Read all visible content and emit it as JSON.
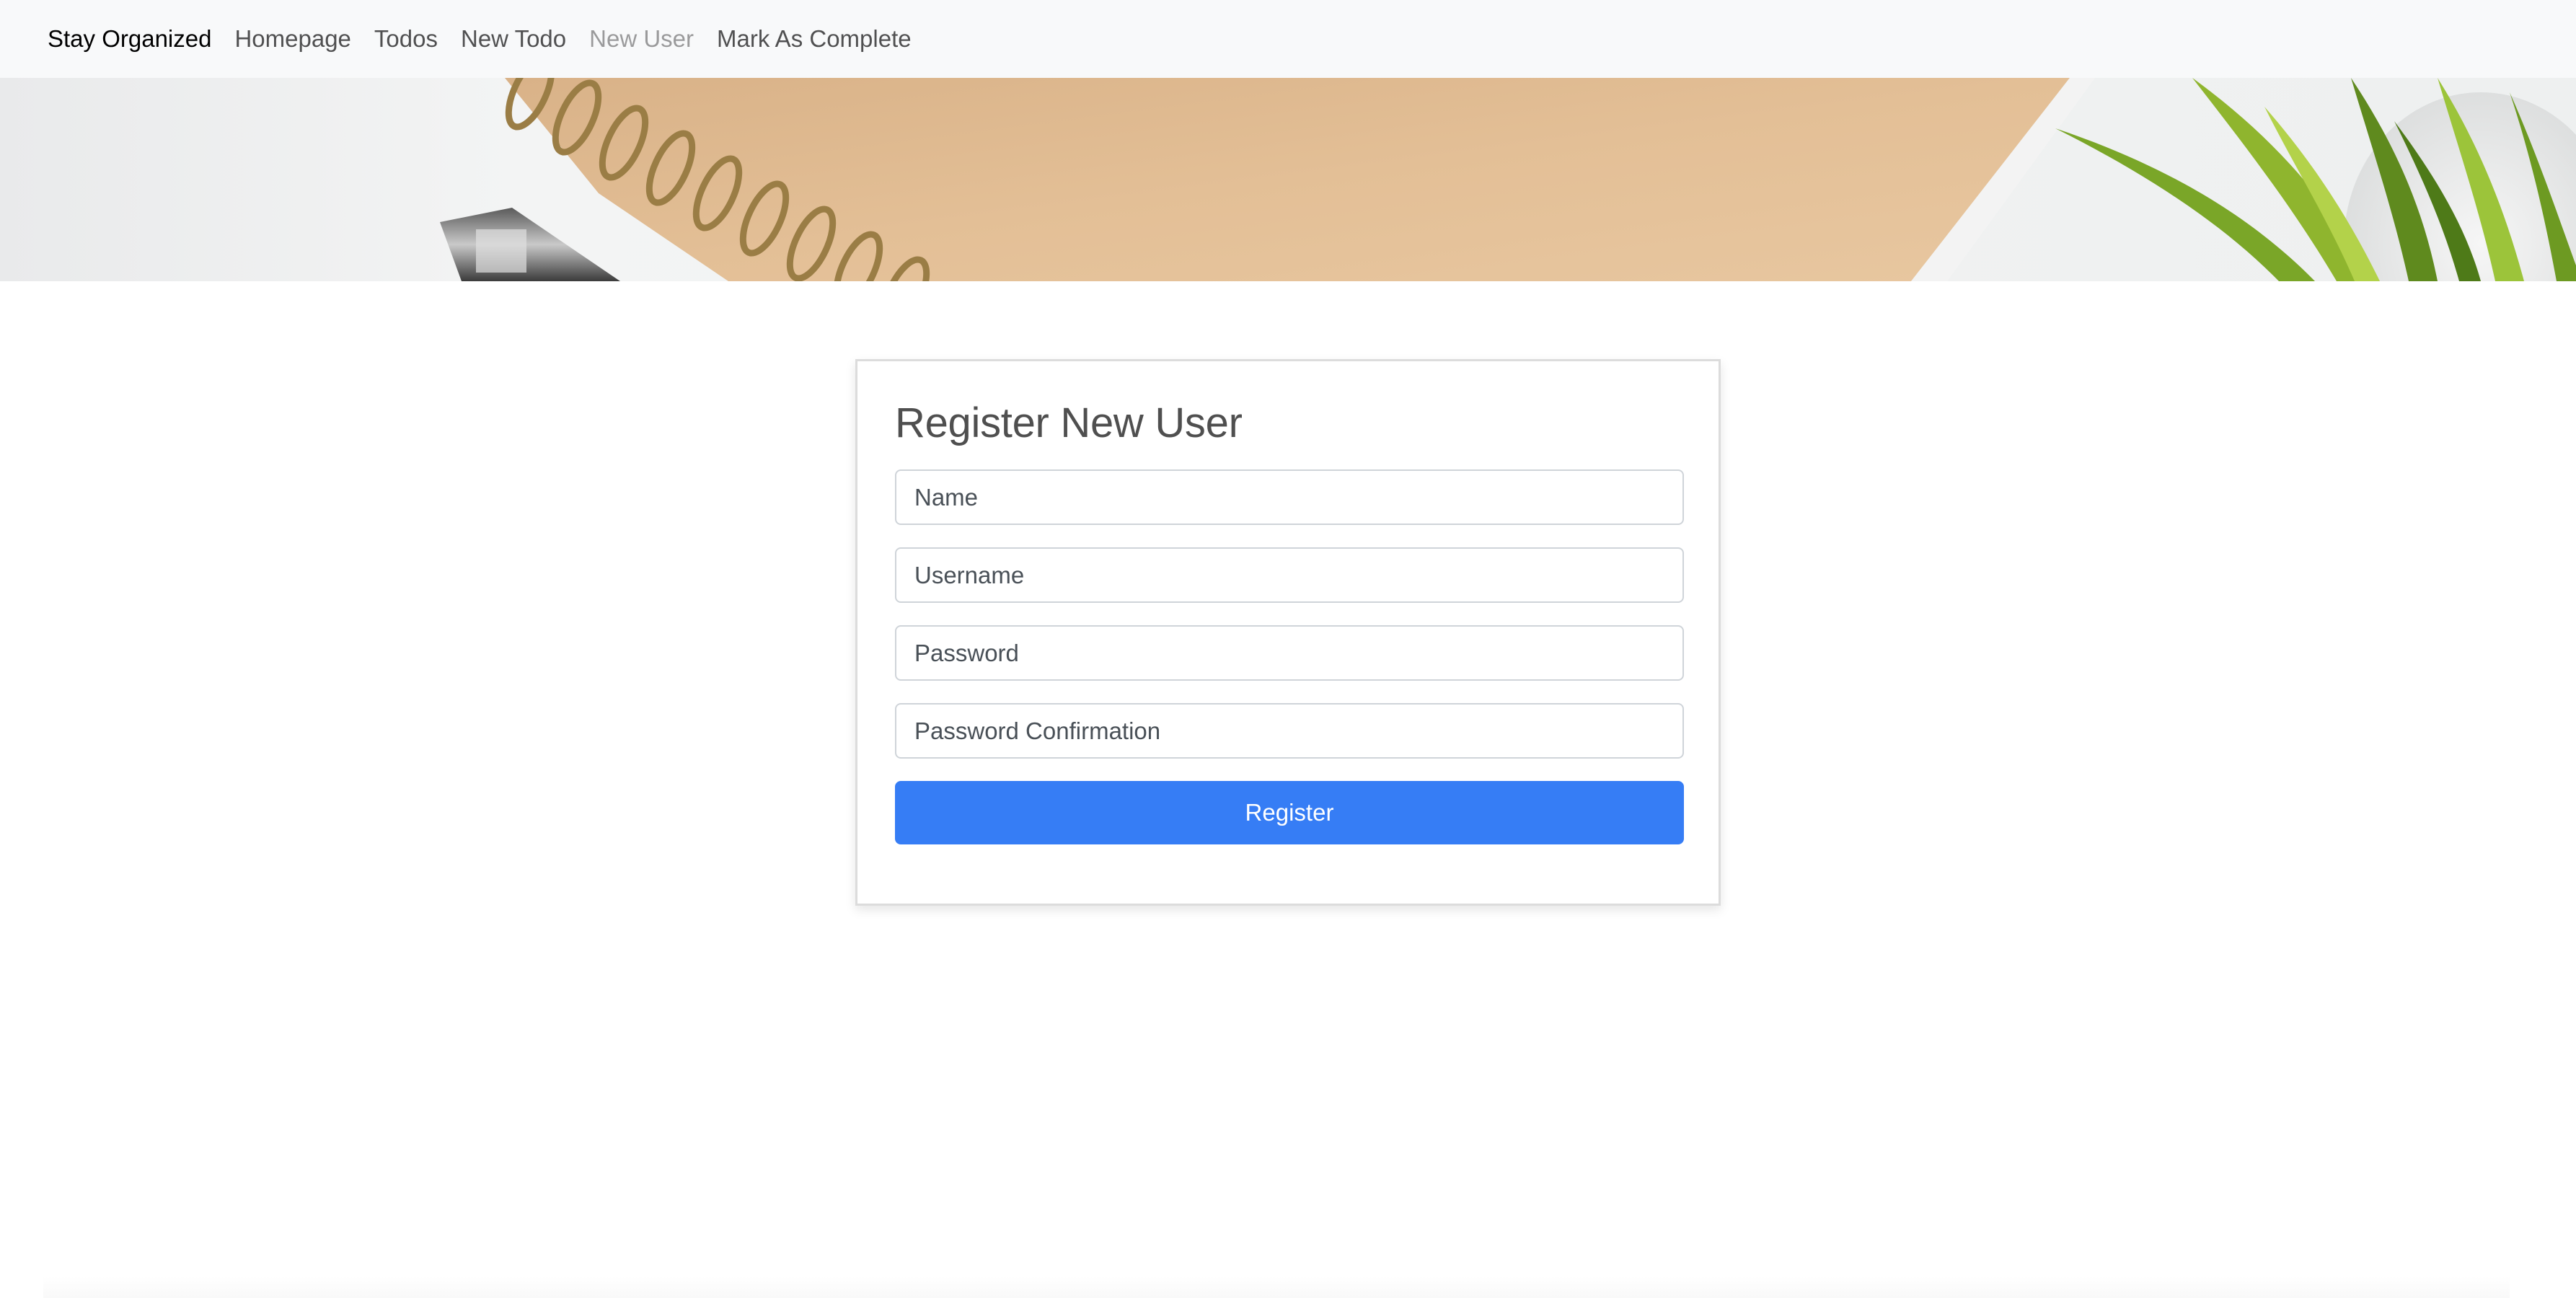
{
  "navbar": {
    "brand": "Stay Organized",
    "links": [
      {
        "label": "Homepage",
        "state": "normal"
      },
      {
        "label": "Todos",
        "state": "normal"
      },
      {
        "label": "New Todo",
        "state": "normal"
      },
      {
        "label": "New User",
        "state": "disabled"
      },
      {
        "label": "Mark As Complete",
        "state": "normal"
      }
    ]
  },
  "banner": {
    "description_icon": "desk-photo-notebook-pen-plant"
  },
  "register_card": {
    "title": "Register New User",
    "fields": {
      "name": {
        "placeholder": "Name",
        "value": ""
      },
      "username": {
        "placeholder": "Username",
        "value": ""
      },
      "password": {
        "placeholder": "Password",
        "value": ""
      },
      "password_confirmation": {
        "placeholder": "Password Confirmation",
        "value": ""
      }
    },
    "submit_label": "Register"
  },
  "colors": {
    "navbar_bg": "#f8f9fa",
    "primary_button": "#367df5",
    "title_text": "#4f4f4f"
  }
}
